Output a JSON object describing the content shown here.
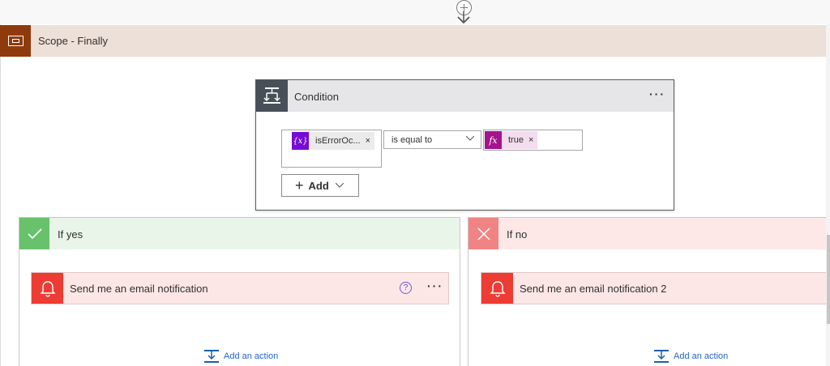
{
  "scope": {
    "title": "Scope - Finally",
    "icon": "scope-icon"
  },
  "condition": {
    "title": "Condition",
    "more_label": "···",
    "left_token": {
      "label": "isErrorOc...",
      "icon": "variable-icon",
      "icon_text": "{x}",
      "remove": "×"
    },
    "operator": "is equal to",
    "right_token": {
      "label": "true",
      "icon": "expression-icon",
      "icon_text": "fx",
      "remove": "×"
    },
    "add_label": "Add"
  },
  "if_yes": {
    "title": "If yes",
    "action": {
      "title": "Send me an email notification",
      "help": "?",
      "more_label": "···"
    },
    "add_action": "Add an action"
  },
  "if_no": {
    "title": "If no",
    "action": {
      "title": "Send me an email notification 2"
    },
    "add_action": "Add an action"
  },
  "colors": {
    "scope_brown": "#8f3a0c",
    "condition_gray": "#484f58",
    "yes_green": "#68c26b",
    "no_red": "#f08484",
    "notification_red": "#ec3c33",
    "link_blue": "#2266c8"
  }
}
